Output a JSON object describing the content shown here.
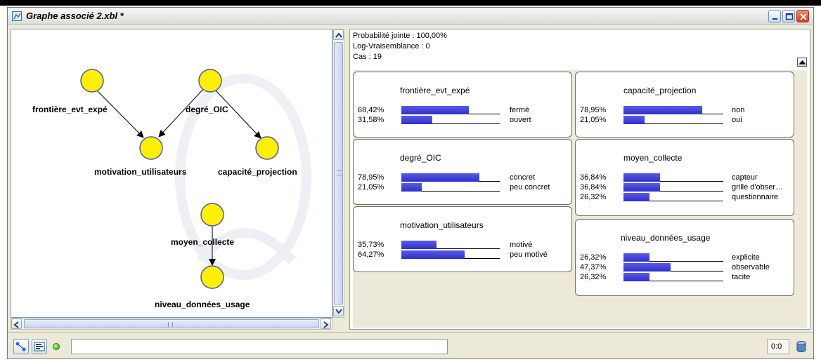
{
  "window": {
    "title": "Graphe associé 2.xbl *"
  },
  "graph": {
    "node_color": "#FFEF00",
    "nodes": [
      {
        "id": "frontiere_evt_expe",
        "label": "frontière_evt_expé"
      },
      {
        "id": "degre_OIC",
        "label": "degré_OIC"
      },
      {
        "id": "motivation_utilisateurs",
        "label": "motivation_utilisateurs"
      },
      {
        "id": "capacite_projection",
        "label": "capacité_projection"
      },
      {
        "id": "moyen_collecte",
        "label": "moyen_collecte"
      },
      {
        "id": "niveau_donnees_usage",
        "label": "niveau_données_usage"
      }
    ],
    "edges": [
      {
        "from": "frontiere_evt_expe",
        "to": "motivation_utilisateurs"
      },
      {
        "from": "degre_OIC",
        "to": "motivation_utilisateurs"
      },
      {
        "from": "degre_OIC",
        "to": "capacite_projection"
      },
      {
        "from": "moyen_collecte",
        "to": "niveau_donnees_usage"
      }
    ]
  },
  "monitor_panel": {
    "joint_probability": "Probabilité jointe : 100,00%",
    "log_likelihood": "Log-Vraisemblance : 0",
    "cases": "Cas : 19"
  },
  "monitors": [
    {
      "title": "frontière_evt_expé",
      "states": [
        {
          "pct_text": "68,42%",
          "label": "fermé",
          "value": 0.6842
        },
        {
          "pct_text": "31,58%",
          "label": "ouvert",
          "value": 0.3158
        }
      ]
    },
    {
      "title": "degré_OIC",
      "states": [
        {
          "pct_text": "78,95%",
          "label": "concret",
          "value": 0.7895
        },
        {
          "pct_text": "21,05%",
          "label": "peu concret",
          "value": 0.2105
        }
      ]
    },
    {
      "title": "motivation_utilisateurs",
      "states": [
        {
          "pct_text": "35,73%",
          "label": "motivé",
          "value": 0.3573
        },
        {
          "pct_text": "64,27%",
          "label": "peu motivé",
          "value": 0.6427
        }
      ]
    },
    {
      "title": "capacité_projection",
      "states": [
        {
          "pct_text": "78,95%",
          "label": "non",
          "value": 0.7895
        },
        {
          "pct_text": "21,05%",
          "label": "oui",
          "value": 0.2105
        }
      ]
    },
    {
      "title": "moyen_collecte",
      "states": [
        {
          "pct_text": "36,84%",
          "label": "capteur",
          "value": 0.3684
        },
        {
          "pct_text": "36,84%",
          "label": "grille d'obser…",
          "value": 0.3684
        },
        {
          "pct_text": "26,32%",
          "label": "questionnaire",
          "value": 0.2632
        }
      ]
    },
    {
      "title": "niveau_données_usage",
      "states": [
        {
          "pct_text": "26,32%",
          "label": "explicite",
          "value": 0.2632
        },
        {
          "pct_text": "47,37%",
          "label": "observable",
          "value": 0.4737
        },
        {
          "pct_text": "26,32%",
          "label": "tacite",
          "value": 0.2632
        }
      ]
    }
  ],
  "statusbar": {
    "input_value": "",
    "coord": "0:0",
    "led_color": "#33CC00"
  },
  "icons": {
    "window": "graph-window-icon",
    "minimize": "minimize-icon",
    "maximize": "maximize-icon",
    "close": "close-icon",
    "collapse": "collapse-up-icon",
    "graph_mode": "graph-mode-icon",
    "monitor_mode": "monitor-mode-icon",
    "database": "database-icon"
  }
}
